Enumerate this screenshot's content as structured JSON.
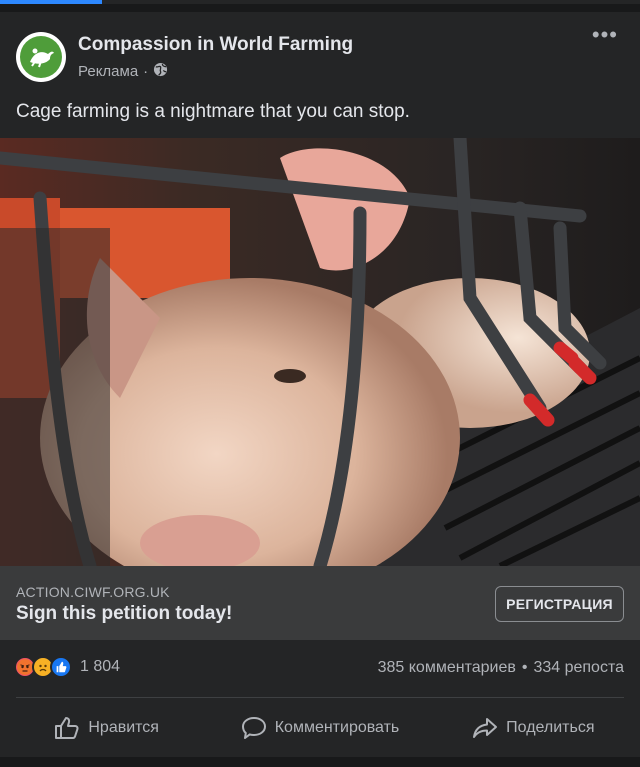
{
  "post": {
    "page_name": "Compassion in World Farming",
    "sponsored_label": "Реклама",
    "meta_separator": "·",
    "caption": "Cage farming is a nightmare that you can stop.",
    "more_label": "•••"
  },
  "link": {
    "domain": "ACTION.CIWF.ORG.UK",
    "title": "Sign this petition today!",
    "cta_label": "РЕГИСТРАЦИЯ"
  },
  "reactions": {
    "count": "1 804",
    "icons": [
      "angry-reaction",
      "sad-reaction",
      "like-reaction"
    ],
    "comments": "385 комментариев",
    "separator": "•",
    "shares": "334 репоста"
  },
  "actions": {
    "like": "Нравится",
    "comment": "Комментировать",
    "share": "Поделиться"
  },
  "colors": {
    "background": "#18191a",
    "card": "#242526",
    "link_box": "#3a3b3c",
    "text_primary": "#e4e6eb",
    "text_secondary": "#b0b3b8",
    "brand_green": "#4f9d3a"
  }
}
